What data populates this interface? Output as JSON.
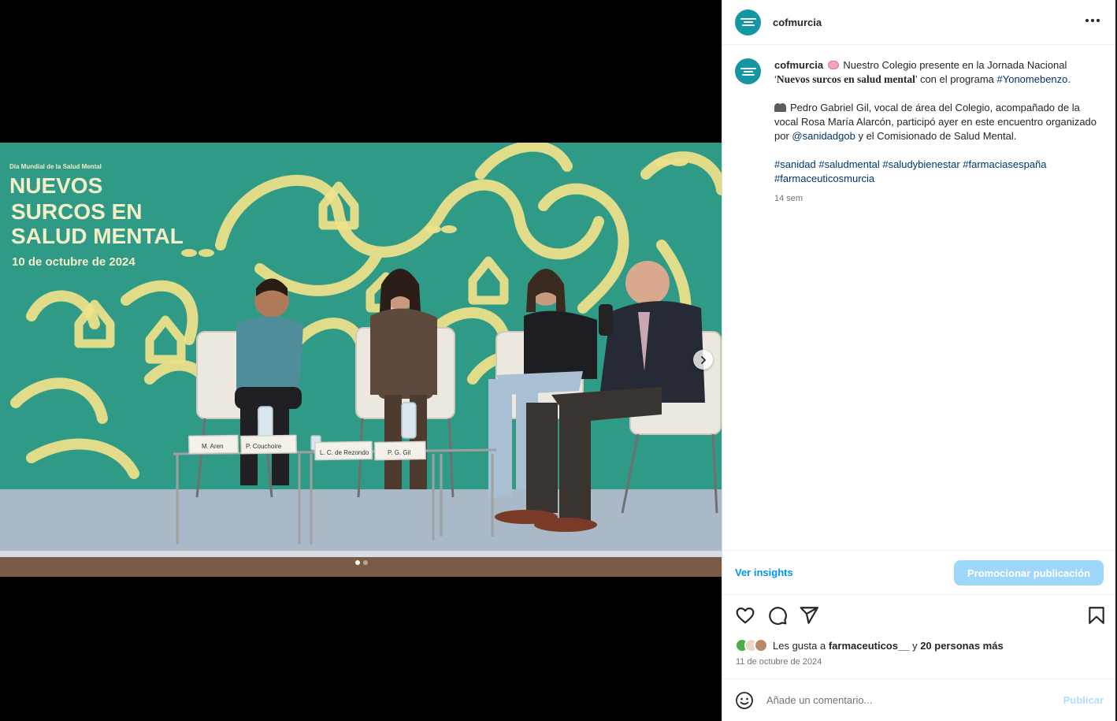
{
  "post": {
    "username": "cofmurcia",
    "caption": {
      "username": "cofmurcia",
      "line1": "Nuestro Colegio presente en la Jornada Nacional",
      "quote_open": "‘",
      "event_name": "Nuevos surcos en salud mental",
      "after_event": "’ con el programa",
      "hashtag_program": "#Yonomebenzo",
      "period": ".",
      "para2_start": "Pedro Gabriel Gil, vocal de área del Colegio, acompañado de la vocal Rosa María Alarcón, participó ayer en este encuentro organizado por ",
      "mention": "@sanidadgob",
      "para2_end": " y el Comisionado de Salud Mental.",
      "hashtags": [
        "#sanidad",
        "#saludmental",
        "#saludybienestar",
        "#farmaciasespaña",
        "#farmaceuticosmurcia"
      ],
      "time_ago": "14 sem",
      "emoji1": "brain-emoji",
      "emoji2": "people-emoji"
    },
    "image": {
      "banner_small": "Día Mundial de la Salud Mental",
      "banner_line1": "NUEVOS",
      "banner_line2": "SURCOS EN",
      "banner_line3": "SALUD MENTAL",
      "banner_date": "10 de octubre de 2024",
      "nameplates": [
        "M. Aren",
        "P. Couchoire",
        "L. C. de Rezondo",
        "P. G. Gil"
      ],
      "carousel_count": 2,
      "carousel_active": 1
    },
    "insights_label": "Ver insights",
    "promote_label": "Promocionar publicación",
    "likes": {
      "prefix": "Les gusta a ",
      "user": "farmaceuticos__",
      "middle": " y ",
      "others": "20 personas más"
    },
    "date": "11 de octubre de 2024",
    "comment": {
      "placeholder": "Añade un comentario...",
      "submit_label": "Publicar"
    }
  },
  "colors": {
    "brand_avatar": "#1596a3",
    "link": "#00376b",
    "accent": "#0095f6",
    "promote_disabled": "#9fd7fb",
    "stage_green": "#2f9a86",
    "pattern_yellow": "#efe28a"
  }
}
